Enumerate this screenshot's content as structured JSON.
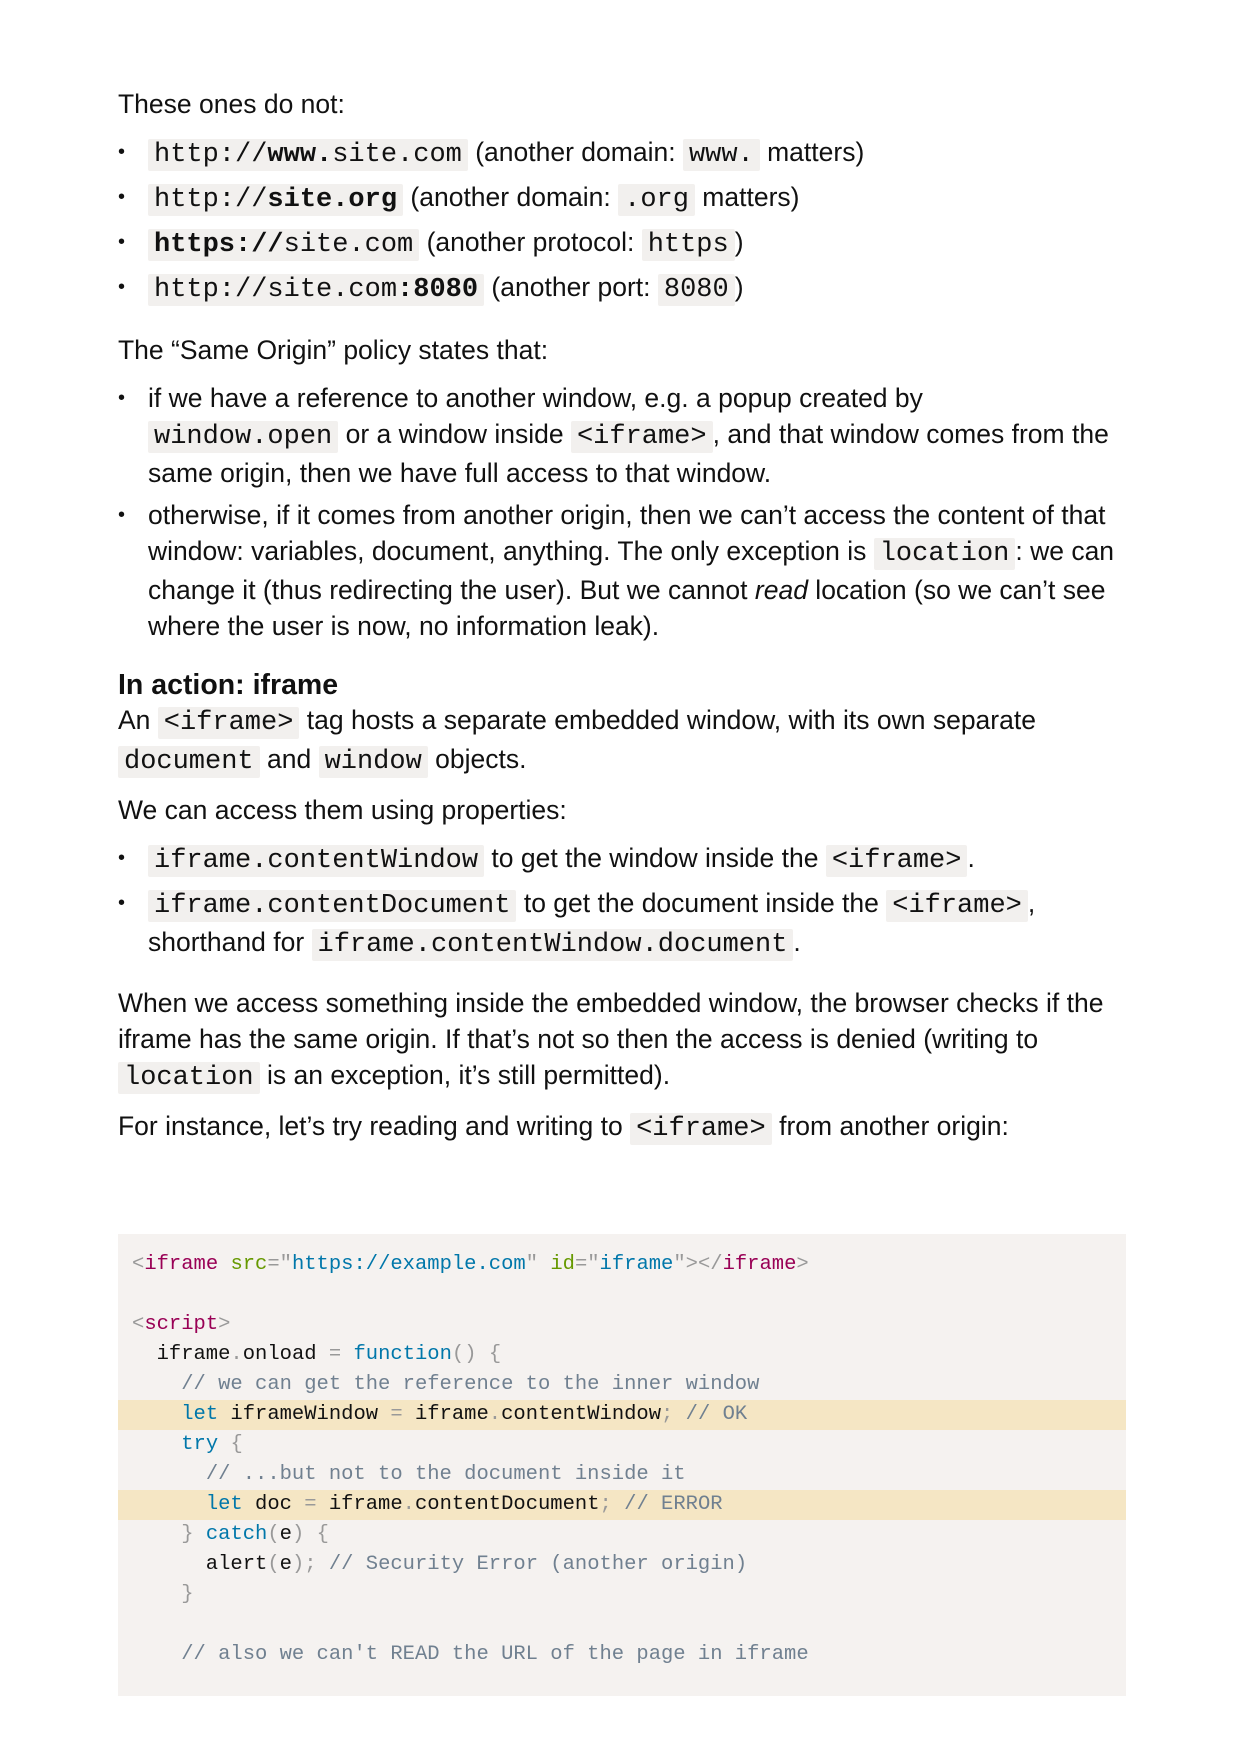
{
  "intro_not_same": "These ones do not:",
  "urls": [
    {
      "pre": "http://",
      "bold": "www.",
      "post": "site.com",
      "note_pre": " (another domain: ",
      "note_code": "www.",
      "note_post": " matters)"
    },
    {
      "pre": "http://",
      "bold": "site.org",
      "post": "",
      "note_pre": " (another domain: ",
      "note_code": ".org",
      "note_post": " matters)"
    },
    {
      "pre": "",
      "bold": "https://",
      "post": "site.com",
      "note_pre": " (another protocol: ",
      "note_code": "https",
      "note_post": ")"
    },
    {
      "pre": "http://site.com",
      "bold": ":8080",
      "post": "",
      "note_pre": " (another port: ",
      "note_code": "8080",
      "note_post": ")"
    }
  ],
  "policy_intro": "The “Same Origin” policy states that:",
  "policy": {
    "item1": {
      "a": "if we have a reference to another window, e.g. a popup created by",
      "code1": "window.open",
      "b": " or a window inside ",
      "code2": "<iframe>",
      "c": ", and that window comes from the same origin, then we have full access to that window."
    },
    "item2": {
      "a": "otherwise, if it comes from another origin, then we can’t access the content of that window: variables, document, anything. The only exception is ",
      "code1": "location",
      "b": ": we can change it (thus redirecting the user). But we cannot ",
      "em": "read",
      "c": " location (so we can’t see where the user is now, no information leak)."
    }
  },
  "section_heading": "In action: iframe",
  "iframe_para": {
    "a": "An ",
    "code1": "<iframe>",
    "b": " tag hosts a separate embedded window, with its own separate ",
    "code2": "document",
    "c": " and ",
    "code3": "window",
    "d": " objects."
  },
  "access_intro": "We can access them using properties:",
  "props": {
    "item1": {
      "code1": "iframe.contentWindow",
      "a": " to get the window inside the ",
      "code2": "<iframe>",
      "b": "."
    },
    "item2": {
      "code1": "iframe.contentDocument",
      "a": " to get the document inside the ",
      "code2": "<iframe>",
      "b": ", shorthand for ",
      "code3": "iframe.contentWindow.document",
      "c": "."
    }
  },
  "check_para": {
    "a": "When we access something inside the embedded window, the browser checks if the iframe has the same origin. If that’s not so then the access is denied (writing to ",
    "code1": "location",
    "b": " is an exception, it’s still permitted)."
  },
  "instance_para": {
    "a": "For instance, let’s try reading and writing to ",
    "code1": "<iframe>",
    "b": " from another origin:"
  },
  "code_lines": [
    {
      "highlight": false,
      "tokens": [
        [
          "p",
          "<"
        ],
        [
          "tag",
          "iframe"
        ],
        [
          "txt",
          " "
        ],
        [
          "attr",
          "src"
        ],
        [
          "p",
          "=\""
        ],
        [
          "str",
          "https://example.com"
        ],
        [
          "p",
          "\""
        ],
        [
          "txt",
          " "
        ],
        [
          "attr",
          "id"
        ],
        [
          "p",
          "=\""
        ],
        [
          "str",
          "iframe"
        ],
        [
          "p",
          "\"></"
        ],
        [
          "tag",
          "iframe"
        ],
        [
          "p",
          ">"
        ]
      ]
    },
    {
      "highlight": false,
      "tokens": []
    },
    {
      "highlight": false,
      "tokens": [
        [
          "p",
          "<"
        ],
        [
          "tag",
          "script"
        ],
        [
          "p",
          ">"
        ]
      ]
    },
    {
      "highlight": false,
      "tokens": [
        [
          "txt",
          "  iframe"
        ],
        [
          "p",
          "."
        ],
        [
          "txt",
          "onload "
        ],
        [
          "p",
          "="
        ],
        [
          "txt",
          " "
        ],
        [
          "kw",
          "function"
        ],
        [
          "p",
          "()"
        ],
        [
          "txt",
          " "
        ],
        [
          "p",
          "{"
        ]
      ]
    },
    {
      "highlight": false,
      "tokens": [
        [
          "txt",
          "    "
        ],
        [
          "com",
          "// we can get the reference to the inner window"
        ]
      ]
    },
    {
      "highlight": true,
      "tokens": [
        [
          "txt",
          "    "
        ],
        [
          "kw",
          "let"
        ],
        [
          "txt",
          " iframeWindow "
        ],
        [
          "p",
          "="
        ],
        [
          "txt",
          " iframe"
        ],
        [
          "p",
          "."
        ],
        [
          "txt",
          "contentWindow"
        ],
        [
          "p",
          ";"
        ],
        [
          "txt",
          " "
        ],
        [
          "com",
          "// OK"
        ]
      ]
    },
    {
      "highlight": false,
      "tokens": [
        [
          "txt",
          "    "
        ],
        [
          "kw",
          "try"
        ],
        [
          "txt",
          " "
        ],
        [
          "p",
          "{"
        ]
      ]
    },
    {
      "highlight": false,
      "tokens": [
        [
          "txt",
          "      "
        ],
        [
          "com",
          "// ...but not to the document inside it"
        ]
      ]
    },
    {
      "highlight": true,
      "tokens": [
        [
          "txt",
          "      "
        ],
        [
          "kw",
          "let"
        ],
        [
          "txt",
          " doc "
        ],
        [
          "p",
          "="
        ],
        [
          "txt",
          " iframe"
        ],
        [
          "p",
          "."
        ],
        [
          "txt",
          "contentDocument"
        ],
        [
          "p",
          ";"
        ],
        [
          "txt",
          " "
        ],
        [
          "com",
          "// ERROR"
        ]
      ]
    },
    {
      "highlight": false,
      "tokens": [
        [
          "txt",
          "    "
        ],
        [
          "p",
          "}"
        ],
        [
          "txt",
          " "
        ],
        [
          "kw",
          "catch"
        ],
        [
          "p",
          "("
        ],
        [
          "txt",
          "e"
        ],
        [
          "p",
          ")"
        ],
        [
          "txt",
          " "
        ],
        [
          "p",
          "{"
        ]
      ]
    },
    {
      "highlight": false,
      "tokens": [
        [
          "txt",
          "      alert"
        ],
        [
          "p",
          "("
        ],
        [
          "txt",
          "e"
        ],
        [
          "p",
          ");"
        ],
        [
          "txt",
          " "
        ],
        [
          "com",
          "// Security Error (another origin)"
        ]
      ]
    },
    {
      "highlight": false,
      "tokens": [
        [
          "txt",
          "    "
        ],
        [
          "p",
          "}"
        ]
      ]
    },
    {
      "highlight": false,
      "tokens": []
    },
    {
      "highlight": false,
      "tokens": [
        [
          "txt",
          "    "
        ],
        [
          "com",
          "// also we can't READ the URL of the page in iframe"
        ]
      ]
    }
  ]
}
